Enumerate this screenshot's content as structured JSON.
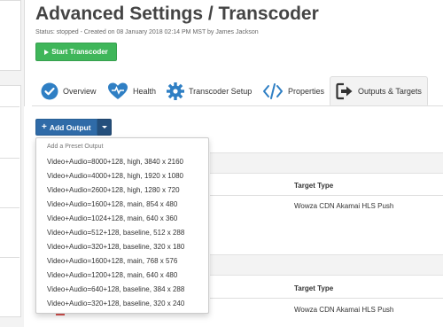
{
  "page": {
    "title": "Advanced Settings / Transcoder",
    "status_line": "Status: stopped - Created on 08 January 2018 02:14 PM MST by James Jackson"
  },
  "actions": {
    "start_label": "Start Transcoder",
    "add_output_label": "Add Output"
  },
  "tabs": [
    {
      "label": "Overview",
      "icon": "check-circle-icon"
    },
    {
      "label": "Health",
      "icon": "heart-pulse-icon"
    },
    {
      "label": "Transcoder Setup",
      "icon": "gear-icon"
    },
    {
      "label": "Properties",
      "icon": "code-icon"
    },
    {
      "label": "Outputs & Targets",
      "icon": "sign-out-icon",
      "active": true
    }
  ],
  "dropdown": {
    "header": "Add a Preset Output",
    "items": [
      "Video+Audio=8000+128, high, 3840 x 2160",
      "Video+Audio=4000+128, high, 1920 x 1080",
      "Video+Audio=2600+128, high, 1280 x 720",
      "Video+Audio=1600+128, main, 854 x 480",
      "Video+Audio=1024+128, main, 640 x 360",
      "Video+Audio=512+128, baseline, 512 x 288",
      "Video+Audio=320+128, baseline, 320 x 180",
      "Video+Audio=1600+128, main, 768 x 576",
      "Video+Audio=1200+128, main, 640 x 480",
      "Video+Audio=640+128, baseline, 384 x 288",
      "Video+Audio=320+128, baseline, 320 x 240"
    ]
  },
  "outputs": [
    {
      "target_header": "Target Type",
      "target_value": "Wowza CDN Akamai HLS Push"
    },
    {
      "target_header": "Target Type",
      "target_value": "Wowza CDN Akamai HLS Push"
    }
  ],
  "colors": {
    "start_green": "#3fb65a",
    "add_blue": "#2f6ba8",
    "icon_blue": "#2f7fc4"
  }
}
